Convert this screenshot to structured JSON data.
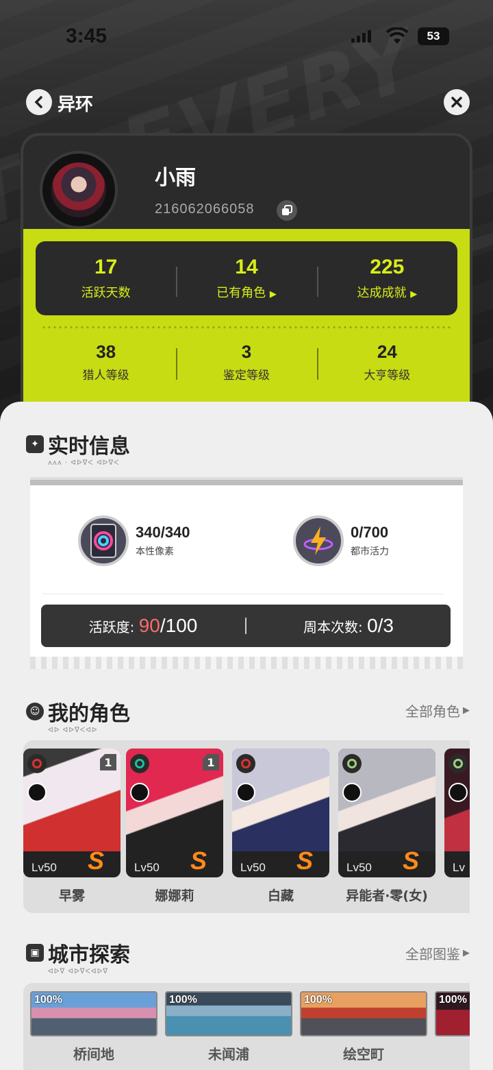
{
  "status_bar": {
    "time": "3:45",
    "battery": "53"
  },
  "nav": {
    "title": "异环"
  },
  "profile": {
    "name": "小雨",
    "uid": "216062066058",
    "primary_stats": [
      {
        "value": "17",
        "label": "活跃天数"
      },
      {
        "value": "14",
        "label": "已有角色"
      },
      {
        "value": "225",
        "label": "达成成就"
      }
    ],
    "secondary_stats": [
      {
        "value": "38",
        "label": "猎人等级"
      },
      {
        "value": "3",
        "label": "鉴定等级"
      },
      {
        "value": "24",
        "label": "大亨等级"
      }
    ]
  },
  "realtime": {
    "title": "实时信息",
    "resources": [
      {
        "value": "340/340",
        "label": "本性像素",
        "icon": "pixel-card-icon"
      },
      {
        "value": "0/700",
        "label": "都市活力",
        "icon": "lightning-icon"
      }
    ],
    "activity": {
      "label": "活跃度:",
      "current": "90",
      "max": "/100"
    },
    "weekly": {
      "label": "周本次数:",
      "value": "0/3"
    }
  },
  "characters": {
    "title": "我的角色",
    "more": "全部角色",
    "items": [
      {
        "name": "早雾",
        "level": "Lv50",
        "rank": "1",
        "element_color": "#e03030",
        "type_icon": "vortex-icon"
      },
      {
        "name": "娜娜莉",
        "level": "Lv50",
        "rank": "1",
        "element_color": "#20c0a0",
        "type_icon": "lightning-icon"
      },
      {
        "name": "白藏",
        "level": "Lv50",
        "rank": "",
        "element_color": "#e03030",
        "type_icon": "atom-icon"
      },
      {
        "name": "异能者·零(女)",
        "level": "Lv50",
        "rank": "",
        "element_color": "#a0d080",
        "type_icon": "cube-icon"
      },
      {
        "name": "",
        "level": "Lv",
        "rank": "",
        "element_color": "#a0d080",
        "type_icon": "cube-icon"
      }
    ]
  },
  "city": {
    "title": "城市探索",
    "more": "全部图鉴",
    "items": [
      {
        "name": "桥间地",
        "progress": "100%"
      },
      {
        "name": "未闻浦",
        "progress": "100%"
      },
      {
        "name": "绘空町",
        "progress": "100%"
      },
      {
        "name": "",
        "progress": "100%"
      }
    ]
  },
  "colors": {
    "accent_lime": "#c8dc14",
    "activity_red": "#ff6a6a",
    "rank_orange": "#ff8a1a"
  }
}
